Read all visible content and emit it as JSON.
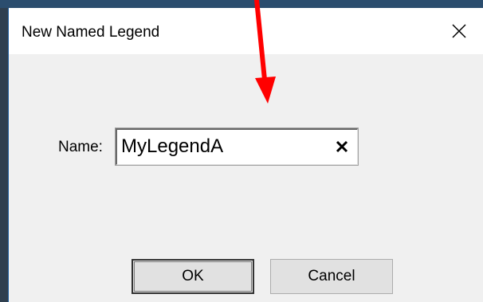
{
  "dialog": {
    "title": "New Named Legend",
    "close_icon": "close-icon"
  },
  "form": {
    "name_label": "Name:",
    "name_value": "MyLegendA",
    "clear_icon": "clear-x-icon"
  },
  "buttons": {
    "ok_label": "OK",
    "cancel_label": "Cancel"
  },
  "annotation": {
    "arrow_color": "#ff0000",
    "arrow_icon": "red-arrow-pointer"
  },
  "colors": {
    "titlebar": "#ffffff",
    "body": "#f0f0f0",
    "button_face": "#e1e1e1"
  }
}
